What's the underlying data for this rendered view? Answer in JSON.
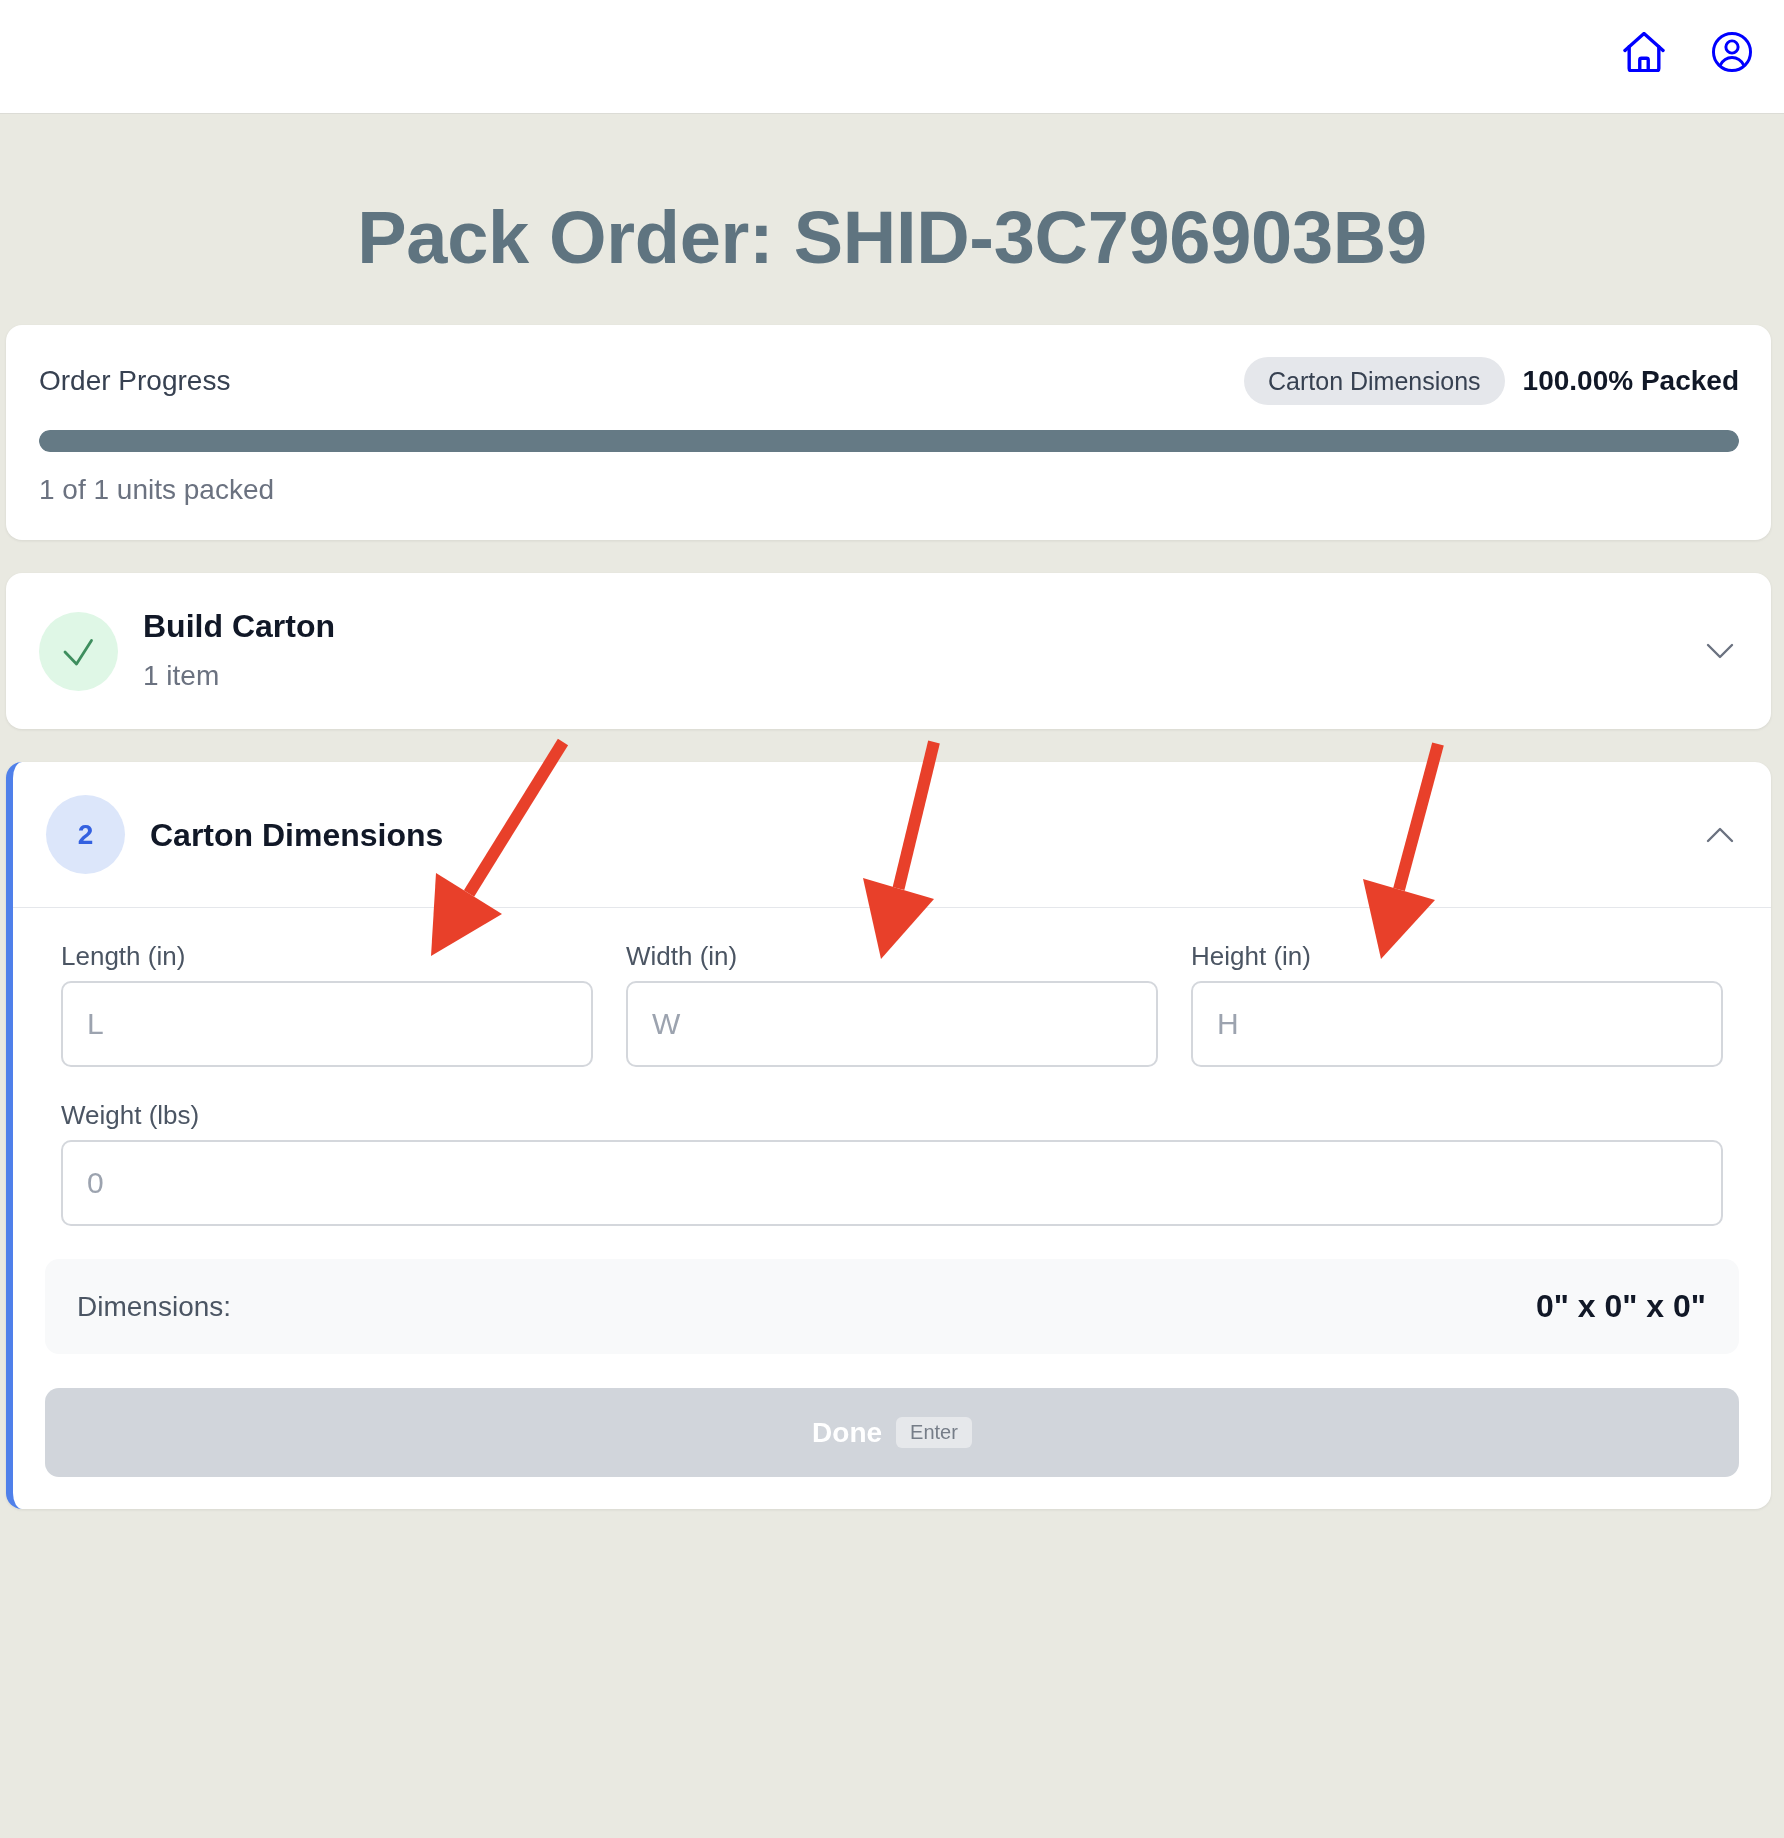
{
  "page": {
    "title": "Pack Order: SHID-3C796903B9"
  },
  "progress": {
    "title": "Order Progress",
    "current_step": "Carton Dimensions",
    "percent_label": "100.00% Packed",
    "level": 1,
    "units_label": "1 of 1 units packed"
  },
  "steps": [
    {
      "title": "Build Carton",
      "subtitle": "1 item",
      "completed": true,
      "active": false,
      "expanded": false
    },
    {
      "number": "2",
      "title": "Carton Dimensions",
      "completed": false,
      "active": true,
      "expanded": true,
      "fields": [
        {
          "kind": "dimension",
          "label": "Length (in)",
          "placeholder": "L",
          "annotated": true
        },
        {
          "kind": "dimension",
          "label": "Width (in)",
          "placeholder": "W",
          "annotated": true
        },
        {
          "kind": "dimension",
          "label": "Height (in)",
          "placeholder": "H",
          "annotated": true
        },
        {
          "kind": "weight",
          "label": "Weight (lbs)",
          "placeholder": "0",
          "annotated": false
        }
      ],
      "summary": {
        "label": "Dimensions:",
        "value": "0\" x 0\" x 0\""
      },
      "button": {
        "label": "Done",
        "shortcut": "Enter",
        "disabled": true
      }
    }
  ]
}
